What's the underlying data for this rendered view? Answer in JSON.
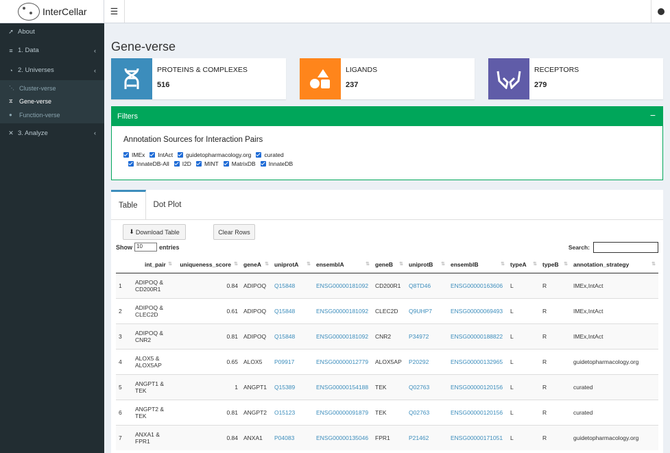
{
  "header": {
    "app_title": "InterCellar",
    "menu_icon": "hamburger-icon",
    "github_icon": "github-icon"
  },
  "sidebar": {
    "items": [
      {
        "label": "About",
        "icon": "rocket-icon"
      },
      {
        "label": "1. Data",
        "icon": "database-icon"
      },
      {
        "label": "2. Universes",
        "icon": "universe-icon"
      },
      {
        "label": "3. Analyze",
        "icon": "analyze-icon"
      }
    ],
    "sub_items": [
      {
        "label": "Cluster-verse",
        "icon": "cluster-icon"
      },
      {
        "label": "Gene-verse",
        "icon": "dna-icon"
      },
      {
        "label": "Function-verse",
        "icon": "function-icon"
      }
    ]
  },
  "page": {
    "title": "Gene-verse"
  },
  "info_boxes": [
    {
      "label": "PROTEINS & COMPLEXES",
      "value": "516",
      "color": "#3c8dbc",
      "icon": "dna-helix-icon"
    },
    {
      "label": "LIGANDS",
      "value": "237",
      "color": "#ff851b",
      "icon": "shapes-icon"
    },
    {
      "label": "RECEPTORS",
      "value": "279",
      "color": "#605ca8",
      "icon": "hands-icon"
    }
  ],
  "filters": {
    "title": "Filters",
    "subtitle": "Annotation Sources for Interaction Pairs",
    "row1": [
      "IMEx",
      "IntAct",
      "guidetopharmacology.org",
      "curated"
    ],
    "row2": [
      "InnateDB-All",
      "I2D",
      "MINT",
      "MatrixDB",
      "InnateDB"
    ]
  },
  "tabs": [
    "Table",
    "Dot Plot"
  ],
  "toolbar": {
    "download": "Download Table",
    "clear": "Clear Rows"
  },
  "table_controls": {
    "show": "Show",
    "entries": "entries",
    "page_length": "10",
    "search": "Search:"
  },
  "table": {
    "columns": [
      "",
      "int_pair",
      "uniqueness_score",
      "geneA",
      "uniprotA",
      "ensemblA",
      "geneB",
      "uniprotB",
      "ensemblB",
      "typeA",
      "typeB",
      "annotation_strategy"
    ],
    "rows": [
      [
        "1",
        "ADIPOQ & CD200R1",
        "0.84",
        "ADIPOQ",
        "Q15848",
        "ENSG00000181092",
        "CD200R1",
        "Q8TD46",
        "ENSG00000163606",
        "L",
        "R",
        "IMEx,IntAct"
      ],
      [
        "2",
        "ADIPOQ & CLEC2D",
        "0.61",
        "ADIPOQ",
        "Q15848",
        "ENSG00000181092",
        "CLEC2D",
        "Q9UHP7",
        "ENSG00000069493",
        "L",
        "R",
        "IMEx,IntAct"
      ],
      [
        "3",
        "ADIPOQ & CNR2",
        "0.81",
        "ADIPOQ",
        "Q15848",
        "ENSG00000181092",
        "CNR2",
        "P34972",
        "ENSG00000188822",
        "L",
        "R",
        "IMEx,IntAct"
      ],
      [
        "4",
        "ALOX5 & ALOX5AP",
        "0.65",
        "ALOX5",
        "P09917",
        "ENSG00000012779",
        "ALOX5AP",
        "P20292",
        "ENSG00000132965",
        "L",
        "R",
        "guidetopharmacology.org"
      ],
      [
        "5",
        "ANGPT1 & TEK",
        "1",
        "ANGPT1",
        "Q15389",
        "ENSG00000154188",
        "TEK",
        "Q02763",
        "ENSG00000120156",
        "L",
        "R",
        "curated"
      ],
      [
        "6",
        "ANGPT2 & TEK",
        "0.81",
        "ANGPT2",
        "O15123",
        "ENSG00000091879",
        "TEK",
        "Q02763",
        "ENSG00000120156",
        "L",
        "R",
        "curated"
      ],
      [
        "7",
        "ANXA1 & FPR1",
        "0.84",
        "ANXA1",
        "P04083",
        "ENSG00000135046",
        "FPR1",
        "P21462",
        "ENSG00000171051",
        "L",
        "R",
        "guidetopharmacology.org"
      ]
    ]
  }
}
